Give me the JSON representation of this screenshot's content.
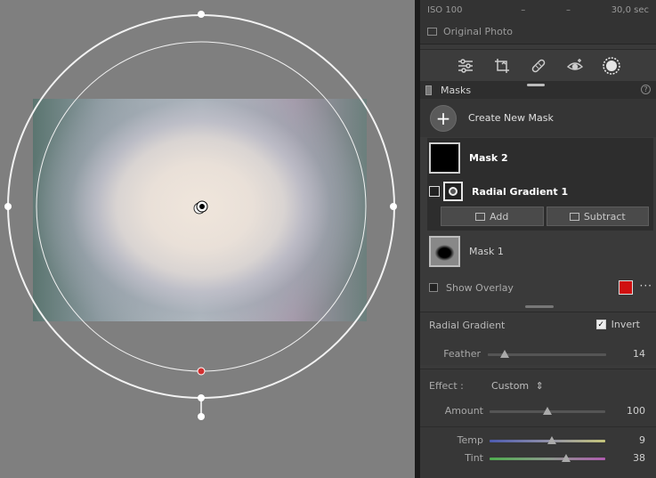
{
  "info": {
    "iso": "ISO 100",
    "dash1": "–",
    "dash2": "–",
    "shutter": "30,0 sec"
  },
  "original_photo_label": "Original Photo",
  "tools": [
    "adjust-sliders-icon",
    "crop-icon",
    "healing-icon",
    "redeye-icon",
    "masks-icon"
  ],
  "masks_header": {
    "title": "Masks",
    "help": "?"
  },
  "create_mask_label": "Create New Mask",
  "mask2": {
    "name": "Mask 2"
  },
  "radial_gradient_item": {
    "name": "Radial Gradient 1"
  },
  "add_label": "Add",
  "subtract_label": "Subtract",
  "mask1": {
    "name": "Mask 1"
  },
  "overlay": {
    "label": "Show Overlay",
    "color": "#d01010",
    "more": "···"
  },
  "radial_section": {
    "title": "Radial Gradient",
    "invert_label": "Invert",
    "invert_checked": true,
    "feather": {
      "label": "Feather",
      "value": "14",
      "position": 0.14
    }
  },
  "effect": {
    "label": "Effect :",
    "preset": "Custom",
    "preset_arrow": "⇕",
    "amount": {
      "label": "Amount",
      "value": "100",
      "position": 0.5
    },
    "temp": {
      "label": "Temp",
      "value": "9",
      "position": 0.54
    },
    "tint": {
      "label": "Tint",
      "value": "38",
      "position": 0.66
    }
  },
  "colors": {
    "panel": "#3a3a3a",
    "canvas": "#7f7f7f",
    "overlay_swatch": "#d01010"
  }
}
